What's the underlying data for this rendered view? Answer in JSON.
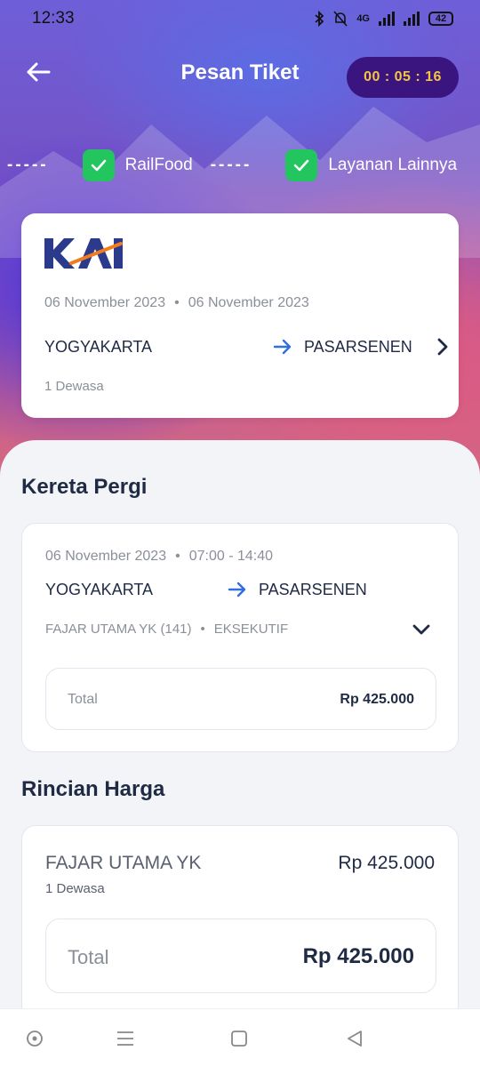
{
  "status_bar": {
    "time": "12:33",
    "network": "4G",
    "battery": "42"
  },
  "header": {
    "title": "Pesan Tiket",
    "timer": "00 : 05 : 16"
  },
  "steps": [
    {
      "label": "RailFood",
      "done": true
    },
    {
      "label": "Layanan Lainnya",
      "done": true
    }
  ],
  "booking_summary": {
    "brand": "KAI",
    "depart_date": "06 November 2023",
    "return_date": "06 November 2023",
    "origin": "YOGYAKARTA",
    "destination": "PASARSENEN",
    "passengers": "1 Dewasa"
  },
  "departure": {
    "section_title": "Kereta Pergi",
    "date": "06 November 2023",
    "time_range": "07:00 - 14:40",
    "origin": "YOGYAKARTA",
    "destination": "PASARSENEN",
    "train": "FAJAR UTAMA YK (141)",
    "class": "EKSEKUTIF",
    "total_label": "Total",
    "total_value": "Rp 425.000"
  },
  "price_details": {
    "section_title": "Rincian Harga",
    "item_name": "FAJAR UTAMA YK",
    "item_price": "Rp 425.000",
    "item_pax": "1 Dewasa",
    "total_label": "Total",
    "total_value": "Rp 425.000"
  },
  "colors": {
    "timer_bg": "#3a1580",
    "timer_text": "#f4c542",
    "check_green": "#22c55e",
    "accent_blue": "#2f6fe0",
    "text_dark": "#1f2a44"
  }
}
